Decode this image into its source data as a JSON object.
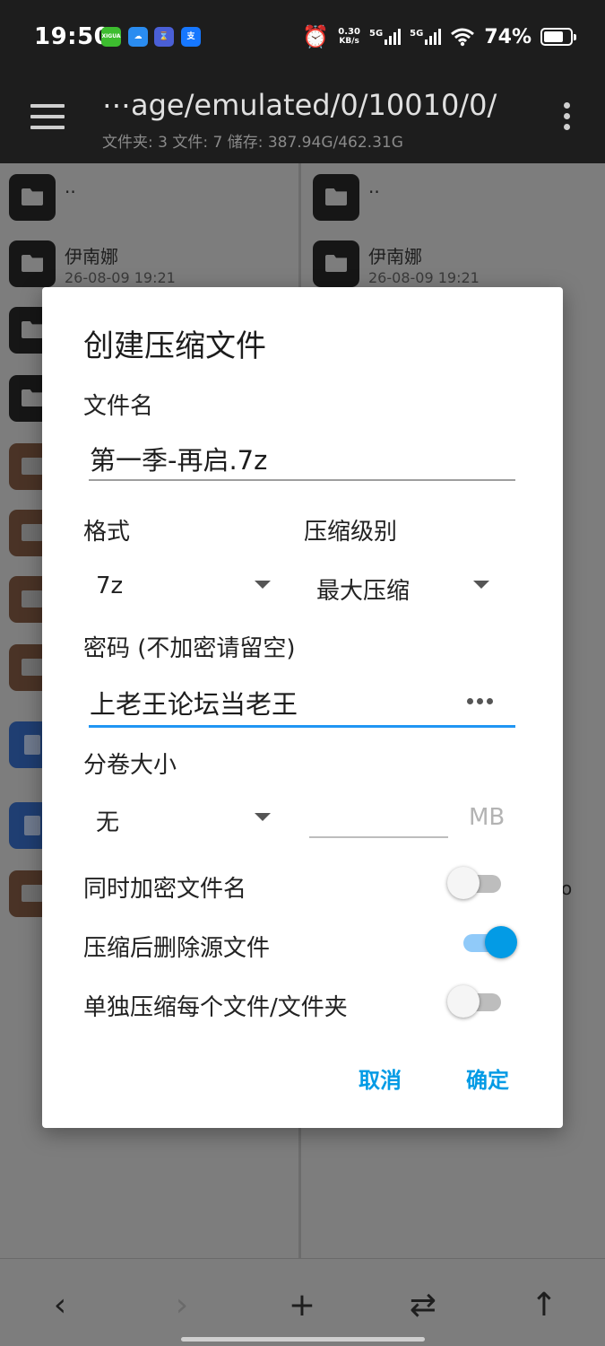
{
  "status_bar": {
    "time": "19:50",
    "net_speed_value": "0.30",
    "net_speed_unit": "KB/s",
    "sim1": "5G",
    "sim2": "5G",
    "battery_percent": "74%",
    "battery_level": 0.74,
    "app_icons": [
      {
        "name": "xigua-app-icon",
        "glyph": "XIGUA",
        "color": "#3dbd2f"
      },
      {
        "name": "cloud-app-icon",
        "glyph": "☁",
        "color": "#2a8cf0"
      },
      {
        "name": "hourglass-app-icon",
        "glyph": "⌛",
        "color": "#4a5fd6"
      },
      {
        "name": "alipay-app-icon",
        "glyph": "支",
        "color": "#1677ff"
      }
    ]
  },
  "toolbar": {
    "path": "⋯age/emulated/0/10010/0/",
    "info": "文件夹: 3  文件: 7  储存: 387.94G/462.31G"
  },
  "panes": {
    "left": [
      {
        "type": "folder",
        "name": "..",
        "date": ""
      },
      {
        "type": "folder",
        "name": "伊南娜",
        "date": "26-08-09 19:21"
      },
      {
        "type": "folder",
        "name": "",
        "date": ""
      },
      {
        "type": "folder",
        "name": "",
        "date": ""
      },
      {
        "type": "archive",
        "name": "",
        "date": ""
      },
      {
        "type": "archive",
        "name": "",
        "date": ""
      },
      {
        "type": "archive",
        "name": "",
        "date": ""
      },
      {
        "type": "archive",
        "name": "",
        "date": ""
      },
      {
        "type": "doc",
        "name": "",
        "date": ""
      },
      {
        "type": "doc",
        "name": "",
        "date": ""
      },
      {
        "type": "archive",
        "name": "",
        "date": ""
      }
    ],
    "right": [
      {
        "type": "folder",
        "name": "..",
        "date": ""
      },
      {
        "type": "folder",
        "name": "伊南娜",
        "date": "26-08-09 19:21"
      }
    ],
    "right_partial_text": "o"
  },
  "dialog": {
    "title": "创建压缩文件",
    "filename_label": "文件名",
    "filename_value": "第一季-再启.7z",
    "format_label": "格式",
    "format_value": "7z",
    "level_label": "压缩级别",
    "level_value": "最大压缩",
    "password_label": "密码 (不加密请留空)",
    "password_value": "上老王论坛当老王",
    "split_label": "分卷大小",
    "split_value": "无",
    "split_unit": "MB",
    "encrypt_names_label": "同时加密文件名",
    "encrypt_names_on": false,
    "delete_source_label": "压缩后删除源文件",
    "delete_source_on": true,
    "separate_label": "单独压缩每个文件/文件夹",
    "separate_on": false,
    "cancel_label": "取消",
    "ok_label": "确定"
  },
  "bottom_bar": {
    "back_glyph": "‹",
    "forward_glyph": "›",
    "add_glyph": "+",
    "swap_glyph": "⇄",
    "up_glyph": "↑"
  }
}
